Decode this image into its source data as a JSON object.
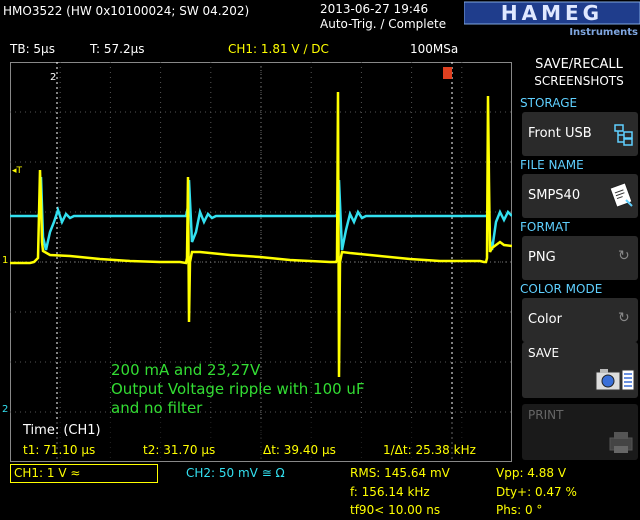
{
  "header": {
    "model": "HMO3522 (HW 0x10100024; SW 04.202)",
    "datetime": "2013-06-27 19:46",
    "trigger_status": "Auto-Trig. / Complete",
    "brand": "HAMEG",
    "brand_sub": "Instruments"
  },
  "status": {
    "timebase": "TB: 5µs",
    "trigger_time": "T: 57.2µs",
    "ch1_trigger": "CH1: 1.81 V ∕ DC",
    "sample_rate": "100MSa"
  },
  "scope": {
    "annotation": [
      "200 mA and 23,27V",
      "Output Voltage ripple with 100 uF",
      "and no filter"
    ],
    "marker_2": "2",
    "marker_T": "◂T",
    "marker_1": "1",
    "marker_2b": "2"
  },
  "cursor": {
    "title": "Time: (CH1)",
    "t1": "t1: 71.10 µs",
    "t2": "t2: 31.70 µs",
    "dt": "Δt: 39.40 µs",
    "inv_dt": "1/Δt: 25.38 kHz"
  },
  "panel": {
    "title1": "SAVE/RECALL",
    "title2": "SCREENSHOTS",
    "storage_label": "STORAGE",
    "storage_value": "Front USB",
    "filename_label": "FILE NAME",
    "filename_value": "SMPS40",
    "format_label": "FORMAT",
    "format_value": "PNG",
    "colormode_label": "COLOR MODE",
    "colormode_value": "Color",
    "save_label": "SAVE",
    "print_label": "PRINT"
  },
  "bottom": {
    "ch1": "CH1: 1 V ≈",
    "ch2": "CH2: 50 mV ≅ Ω",
    "rms": "RMS: 145.64 mV",
    "freq": "f: 156.14 kHz",
    "tf90": "tf90< 10.00 ns",
    "vpp": "Vpp: 4.88 V",
    "dty": "Dty+: 0.47 %",
    "phs": "Phs: 0 °"
  },
  "colors": {
    "ch1": "#ffff00",
    "ch2": "#33e0f0",
    "annotation": "#33dd33",
    "panel_heading": "#5fd0ff"
  }
}
